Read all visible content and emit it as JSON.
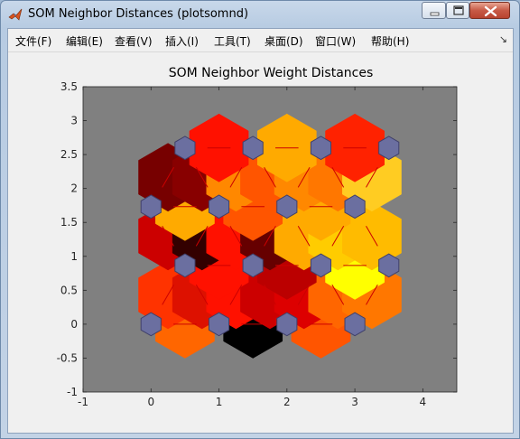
{
  "window": {
    "title": "SOM Neighbor Distances (plotsomnd)"
  },
  "menu": [
    {
      "label": "文件(F)"
    },
    {
      "label": "编辑(E)"
    },
    {
      "label": "查看(V)"
    },
    {
      "label": "插入(I)"
    },
    {
      "label": "工具(T)"
    },
    {
      "label": "桌面(D)"
    },
    {
      "label": "窗口(W)"
    },
    {
      "label": "帮助(H)"
    }
  ],
  "menu_overflow": "↘",
  "chart_data": {
    "type": "heatmap",
    "title": "SOM Neighbor Weight Distances",
    "xlabel": "",
    "ylabel": "",
    "xlim": [
      -1,
      4.5
    ],
    "ylim": [
      -1,
      3.5
    ],
    "xticks": [
      -1,
      0,
      1,
      2,
      3,
      4
    ],
    "yticks": [
      -1,
      -0.5,
      0,
      0.5,
      1,
      1.5,
      2,
      2.5,
      3,
      3.5
    ],
    "xtick_labels": [
      "-1",
      "0",
      "1",
      "2",
      "3",
      "4"
    ],
    "ytick_labels": [
      "-1",
      "-0.5",
      "0",
      "0.5",
      "1",
      "1.5",
      "2",
      "2.5",
      "3",
      "3.5"
    ],
    "grid": false,
    "background_color": "#808080",
    "neuron_color": "#6b6fa0",
    "neuron_edge_color": "#40406a",
    "connection_line_color": "#cc0000",
    "neurons": [
      {
        "x": 0,
        "y": 0
      },
      {
        "x": 1,
        "y": 0
      },
      {
        "x": 2,
        "y": 0
      },
      {
        "x": 3,
        "y": 0
      },
      {
        "x": 0.5,
        "y": 0.866
      },
      {
        "x": 1.5,
        "y": 0.866
      },
      {
        "x": 2.5,
        "y": 0.866
      },
      {
        "x": 3.5,
        "y": 0.866
      },
      {
        "x": 0,
        "y": 1.732
      },
      {
        "x": 1,
        "y": 1.732
      },
      {
        "x": 2,
        "y": 1.732
      },
      {
        "x": 3,
        "y": 1.732
      },
      {
        "x": 0.5,
        "y": 2.598
      },
      {
        "x": 1.5,
        "y": 2.598
      },
      {
        "x": 2.5,
        "y": 2.598
      },
      {
        "x": 3.5,
        "y": 2.598
      }
    ],
    "distance_patches": [
      {
        "x": 0.5,
        "y": 0,
        "color": "#ff6600"
      },
      {
        "x": 1.5,
        "y": 0,
        "color": "#000000"
      },
      {
        "x": 2.5,
        "y": 0,
        "color": "#ff5500"
      },
      {
        "x": 0.25,
        "y": 0.433,
        "color": "#ff3300"
      },
      {
        "x": 0.75,
        "y": 0.433,
        "color": "#dd1100"
      },
      {
        "x": 1.25,
        "y": 0.433,
        "color": "#ff1100"
      },
      {
        "x": 1.75,
        "y": 0.433,
        "color": "#cc0000"
      },
      {
        "x": 2.25,
        "y": 0.433,
        "color": "#dd0000"
      },
      {
        "x": 2.75,
        "y": 0.433,
        "color": "#ff6600"
      },
      {
        "x": 3.25,
        "y": 0.433,
        "color": "#ff7700"
      },
      {
        "x": 1,
        "y": 0.866,
        "color": "#ff1100"
      },
      {
        "x": 2,
        "y": 0.866,
        "color": "#bb0000"
      },
      {
        "x": 3,
        "y": 0.866,
        "color": "#ffff00"
      },
      {
        "x": 0.25,
        "y": 1.299,
        "color": "#cc0000"
      },
      {
        "x": 0.75,
        "y": 1.299,
        "color": "#330000"
      },
      {
        "x": 1.25,
        "y": 1.299,
        "color": "#ff1100"
      },
      {
        "x": 1.75,
        "y": 1.299,
        "color": "#660000"
      },
      {
        "x": 2.25,
        "y": 1.299,
        "color": "#ffaa00"
      },
      {
        "x": 2.75,
        "y": 1.299,
        "color": "#ffcc00"
      },
      {
        "x": 3.25,
        "y": 1.299,
        "color": "#ffbb00"
      },
      {
        "x": 0.5,
        "y": 1.732,
        "color": "#ffaa00"
      },
      {
        "x": 1.5,
        "y": 1.732,
        "color": "#ff5500"
      },
      {
        "x": 2.5,
        "y": 1.732,
        "color": "#ffaa00"
      },
      {
        "x": 0.25,
        "y": 2.165,
        "color": "#770000"
      },
      {
        "x": 0.75,
        "y": 2.165,
        "color": "#880000"
      },
      {
        "x": 1.25,
        "y": 2.165,
        "color": "#ff8800"
      },
      {
        "x": 1.75,
        "y": 2.165,
        "color": "#ff5500"
      },
      {
        "x": 2.25,
        "y": 2.165,
        "color": "#ff8800"
      },
      {
        "x": 2.75,
        "y": 2.165,
        "color": "#ff7700"
      },
      {
        "x": 3.25,
        "y": 2.165,
        "color": "#ffcc22"
      },
      {
        "x": 1,
        "y": 2.598,
        "color": "#ff1100"
      },
      {
        "x": 2,
        "y": 2.598,
        "color": "#ffaa00"
      },
      {
        "x": 3,
        "y": 2.598,
        "color": "#ff2200"
      }
    ]
  }
}
